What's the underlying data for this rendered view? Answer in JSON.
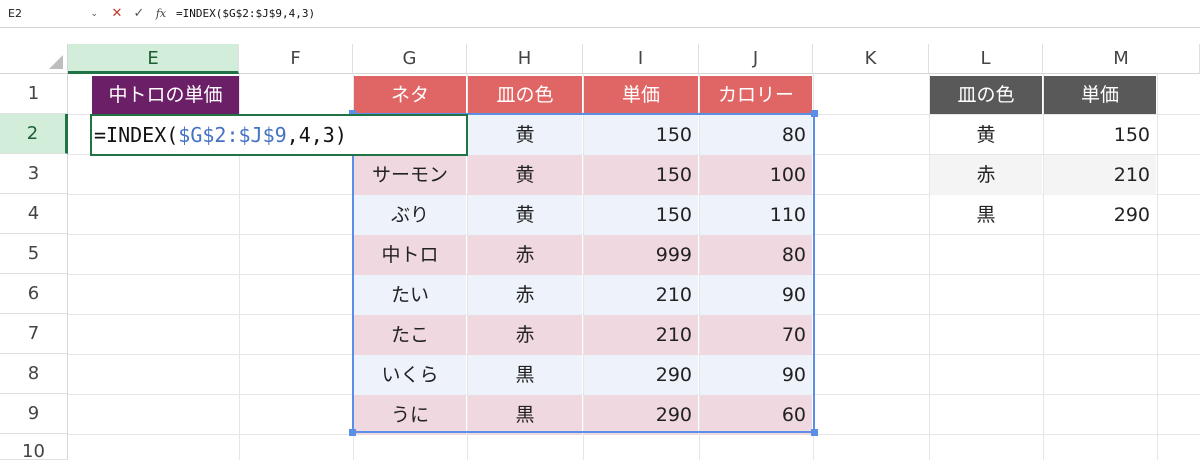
{
  "formula_bar": {
    "name_box": "E2",
    "cancel_icon": "cancel-icon",
    "enter_icon": "enter-icon",
    "fx_label": "fx",
    "formula": "=INDEX($G$2:$J$9,4,3)"
  },
  "columns": [
    "E",
    "F",
    "G",
    "H",
    "I",
    "J",
    "K",
    "L",
    "M"
  ],
  "rows": [
    "1",
    "2",
    "3",
    "4",
    "5",
    "6",
    "7",
    "8",
    "9",
    "10"
  ],
  "selected_cell": "E2",
  "e1_header": "中トロの単価",
  "editing": {
    "prefix": "=INDEX(",
    "ref": "$G$2:$J$9",
    "suffix": ",4,3)"
  },
  "sushi_table": {
    "headers": [
      "ネタ",
      "皿の色",
      "単価",
      "カロリー"
    ],
    "header_color": "#e06666",
    "rows": [
      {
        "neta": "",
        "color": "黄",
        "price": "150",
        "kcal": "80"
      },
      {
        "neta": "サーモン",
        "color": "黄",
        "price": "150",
        "kcal": "100"
      },
      {
        "neta": "ぶり",
        "color": "黄",
        "price": "150",
        "kcal": "110"
      },
      {
        "neta": "中トロ",
        "color": "赤",
        "price": "999",
        "kcal": "80"
      },
      {
        "neta": "たい",
        "color": "赤",
        "price": "210",
        "kcal": "90"
      },
      {
        "neta": "たこ",
        "color": "赤",
        "price": "210",
        "kcal": "70"
      },
      {
        "neta": "いくら",
        "color": "黒",
        "price": "290",
        "kcal": "90"
      },
      {
        "neta": "うに",
        "color": "黒",
        "price": "290",
        "kcal": "60"
      }
    ]
  },
  "price_table": {
    "headers": [
      "皿の色",
      "単価"
    ],
    "header_color": "#595959",
    "rows": [
      {
        "color": "黄",
        "price": "150"
      },
      {
        "color": "赤",
        "price": "210"
      },
      {
        "color": "黒",
        "price": "290"
      }
    ]
  }
}
